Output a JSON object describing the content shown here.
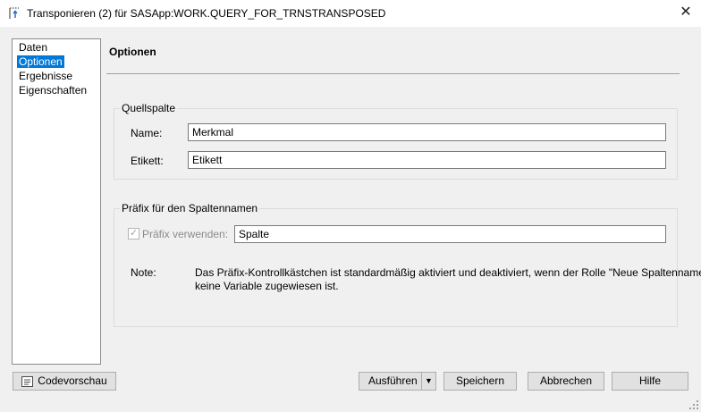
{
  "window": {
    "title": "Transponieren (2) für SASApp:WORK.QUERY_FOR_TRNSTRANSPOSED",
    "close_glyph": "✕",
    "icon": "transpose-icon"
  },
  "nav": {
    "items": [
      {
        "label": "Daten",
        "selected": false
      },
      {
        "label": "Optionen",
        "selected": true
      },
      {
        "label": "Ergebnisse",
        "selected": false
      },
      {
        "label": "Eigenschaften",
        "selected": false
      }
    ]
  },
  "main": {
    "section_title": "Optionen",
    "quellspalte": {
      "legend": "Quellspalte",
      "name_label": "Name:",
      "name_value": "Merkmal",
      "etikett_label": "Etikett:",
      "etikett_value": "Etikett"
    },
    "praefix": {
      "legend": "Präfix für den Spaltennamen",
      "checkbox_checked": true,
      "checkbox_enabled": false,
      "checkbox_label": "Präfix verwenden:",
      "prefix_value": "Spalte",
      "note_label": "Note:",
      "note_line1": "Das Präfix-Kontrollkästchen ist standardmäßig aktiviert und deaktiviert, wenn der Rolle \"Neue Spaltennamen\"",
      "note_line2": "keine Variable zugewiesen ist."
    }
  },
  "footer": {
    "code_preview_label": "Codevorschau",
    "run_label": "Ausführen",
    "save_label": "Speichern",
    "cancel_label": "Abbrechen",
    "help_label": "Hilfe"
  },
  "colors": {
    "selection": "#0078d7",
    "window_bg": "#f0f0f0",
    "button_bg": "#e1e1e1"
  }
}
